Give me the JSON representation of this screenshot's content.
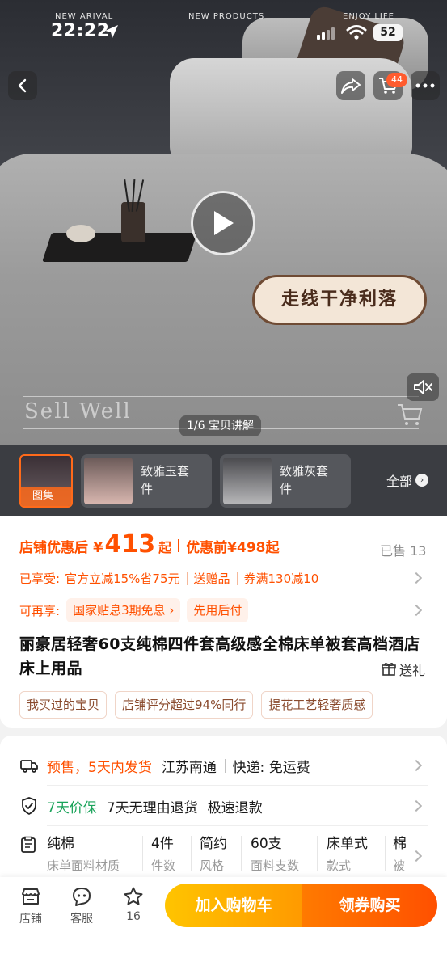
{
  "status_bar": {
    "time": "22:22",
    "battery": "52",
    "overlay_texts": [
      "NEW ARIVAL",
      "NEW PRODUCTS",
      "ENJOY LIFE"
    ]
  },
  "nav": {
    "back_icon": "chevron-left-icon",
    "share_icon": "share-icon",
    "cart_icon": "cart-icon",
    "cart_count": "44",
    "more_icon": "more-icon"
  },
  "media": {
    "badge_text": "走线干净利落",
    "watermark": "Sell Well",
    "counter": "1/6 宝贝讲解"
  },
  "thumbnails": {
    "main_label": "图集",
    "styles": [
      {
        "label": "致雅玉套件"
      },
      {
        "label": "致雅灰套件"
      }
    ],
    "all_label": "全部"
  },
  "price": {
    "prefix": "店铺优惠后",
    "currency": "¥",
    "amount": "413",
    "suffix": "起",
    "original": "优惠前¥498起",
    "sold": "已售 13"
  },
  "promo": {
    "enjoyed_label": "已享受:",
    "items": [
      "官方立减15%省75元",
      "送赠品",
      "券满130减10"
    ],
    "available_label": "可再享:",
    "chips": [
      "国家贴息3期免息 ›",
      "先用后付"
    ]
  },
  "product": {
    "title": "丽豪居轻奢60支纯棉四件套高级感全棉床单被套高档酒店床上用品",
    "gift": "送礼",
    "tags": [
      "我买过的宝贝",
      "店铺评分超过94%同行",
      "提花工艺轻奢质感"
    ]
  },
  "shipping": {
    "presale": "预售，5天内发货",
    "origin": "江苏南通",
    "divider": "|",
    "courier": "快递: 免运费"
  },
  "guarantee": {
    "price_protect": "7天价保",
    "return": "7天无理由退货",
    "refund": "极速退款"
  },
  "params": [
    {
      "value": "纯棉",
      "key": "床单面料材质"
    },
    {
      "value": "4件",
      "key": "件数"
    },
    {
      "value": "简约",
      "key": "风格"
    },
    {
      "value": "60支",
      "key": "面料支数"
    },
    {
      "value": "床单式",
      "key": "款式"
    },
    {
      "value": "棉",
      "key": "被"
    }
  ],
  "bottom_bar": {
    "shop": "店铺",
    "service": "客服",
    "favorites": "16",
    "add_to_cart": "加入购物车",
    "buy": "领券购买"
  },
  "colors": {
    "accent": "#ff5000",
    "cart_button": "#ffb000",
    "green": "#1aa35a"
  }
}
